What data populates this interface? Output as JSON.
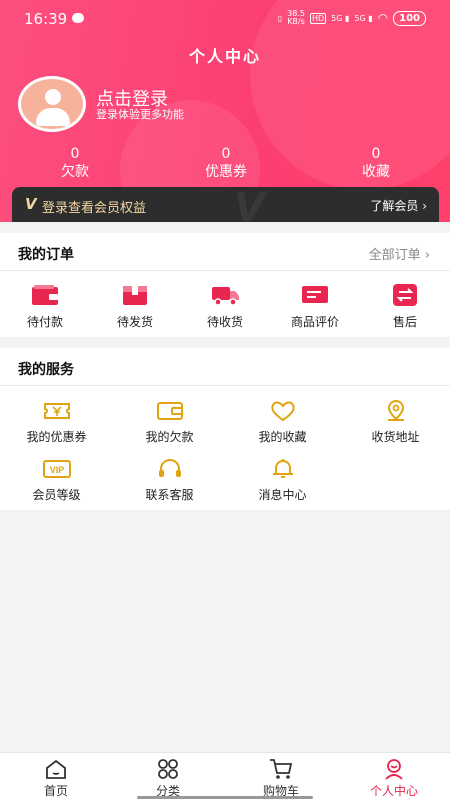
{
  "status_bar": {
    "time": "16:39",
    "net_speed_value": "38.5",
    "net_speed_unit": "KB/s",
    "hd_label": "HD",
    "sim1": "5G",
    "sim2": "5G",
    "battery": "100"
  },
  "header": {
    "title": "个人中心",
    "login_title": "点击登录",
    "login_subtitle": "登录体验更多功能"
  },
  "stats": [
    {
      "value": "0",
      "label": "欠款"
    },
    {
      "value": "0",
      "label": "优惠券"
    },
    {
      "value": "0",
      "label": "收藏"
    }
  ],
  "vip_bar": {
    "badge": "V",
    "text": "登录查看会员权益",
    "link": "了解会员"
  },
  "orders": {
    "title": "我的订单",
    "all_link": "全部订单",
    "items": [
      {
        "label": "待付款",
        "icon": "wallet-icon"
      },
      {
        "label": "待发货",
        "icon": "package-icon"
      },
      {
        "label": "待收货",
        "icon": "truck-icon"
      },
      {
        "label": "商品评价",
        "icon": "review-icon"
      },
      {
        "label": "售后",
        "icon": "after-sales-icon"
      }
    ]
  },
  "services": {
    "title": "我的服务",
    "items": [
      {
        "label": "我的优惠券",
        "icon": "coupon-icon"
      },
      {
        "label": "我的欠款",
        "icon": "wallet-outline-icon"
      },
      {
        "label": "我的收藏",
        "icon": "heart-icon"
      },
      {
        "label": "收货地址",
        "icon": "location-icon"
      },
      {
        "label": "会员等级",
        "icon": "vip-icon"
      },
      {
        "label": "联系客服",
        "icon": "headset-icon"
      },
      {
        "label": "消息中心",
        "icon": "bell-icon"
      }
    ]
  },
  "tabbar": [
    {
      "label": "首页",
      "icon": "home-icon"
    },
    {
      "label": "分类",
      "icon": "grid-icon"
    },
    {
      "label": "购物车",
      "icon": "cart-icon"
    },
    {
      "label": "个人中心",
      "icon": "person-icon",
      "active": true
    }
  ],
  "colors": {
    "brand": "#fc4478",
    "icon_red": "#e8264f",
    "icon_gold": "#e0a410",
    "active_tab": "#e8234e",
    "vip_gold": "#f1d6a3"
  }
}
